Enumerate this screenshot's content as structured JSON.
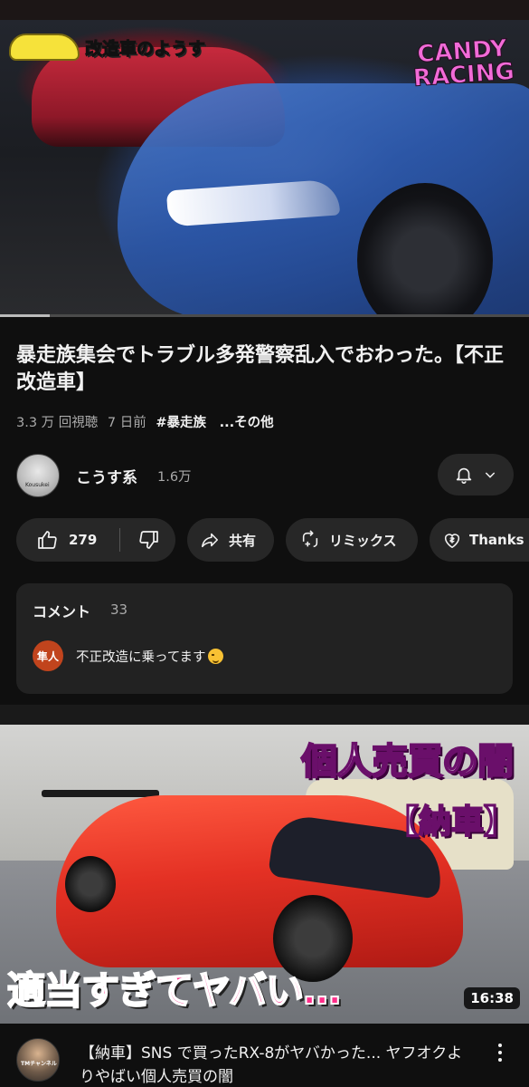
{
  "player": {
    "overlay_text": "改造車のようす",
    "logo_line1": "CANDY",
    "logo_line2": "RACING",
    "progress_fraction": 0.094
  },
  "video": {
    "title": "暴走族集会でトラブル多発警察乱入でおわった。【不正改造車】",
    "views": "3.3 万 回視聴",
    "age": "7 日前",
    "hashtag": "#暴走族",
    "more": "...その他"
  },
  "channel": {
    "name": "こうす系",
    "subscribers": "1.6万",
    "avatar_text": "Kousukei"
  },
  "actions": {
    "like_count": "279",
    "share_label": "共有",
    "remix_label": "リミックス",
    "thanks_label": "Thanks"
  },
  "comments": {
    "header": "コメント",
    "count": "33",
    "top_avatar_text": "隼人",
    "top_comment": "不正改造に乗ってます"
  },
  "recommended": {
    "thumb_text_top": "個人売買の闇",
    "thumb_text_mid": "【納車】",
    "thumb_text_bottom": "適当すぎてヤバい…",
    "duration": "16:38",
    "title": "【納車】SNS で買ったRX-8がヤバかった... ヤフオクよりやばい個人売買の闇",
    "channel_avatar_text": "TMチャンネル"
  },
  "colors": {
    "background": "#0f0f0f",
    "chip": "#272727",
    "comment_box": "#222222",
    "secondary_text": "#aaaaaa",
    "comment_avatar": "#c1441d"
  },
  "icons": [
    "like-icon",
    "dislike-icon",
    "share-icon",
    "remix-icon",
    "thanks-icon",
    "bell-icon",
    "chevron-down-icon",
    "more-vert-icon"
  ]
}
